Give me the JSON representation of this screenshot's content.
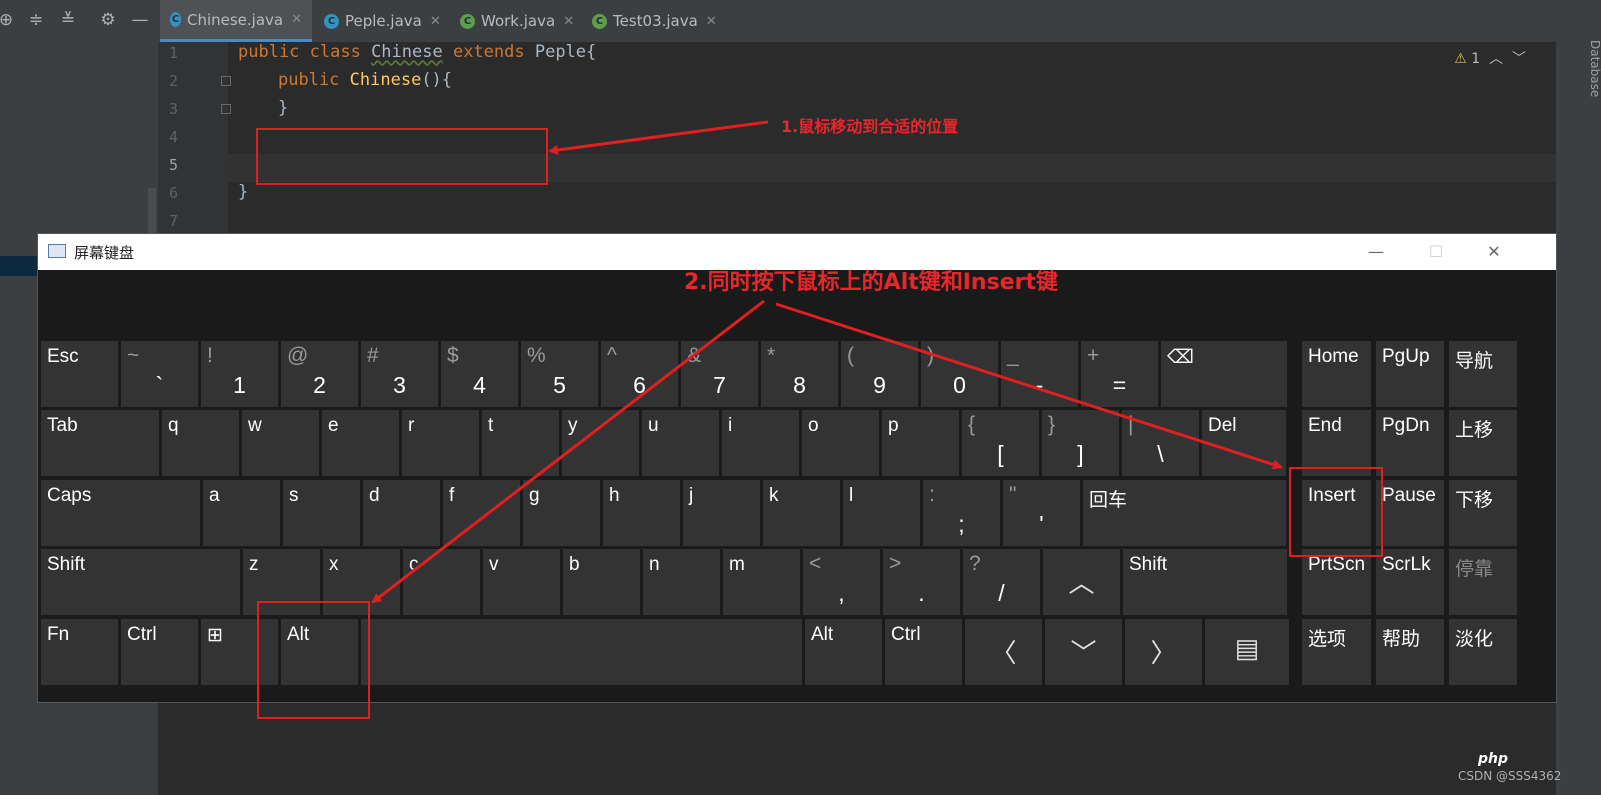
{
  "ide": {
    "tabs": [
      {
        "icon": "C",
        "label": "Chinese.java",
        "close": "✕"
      },
      {
        "icon": "C",
        "label": "Peple.java",
        "close": "✕"
      },
      {
        "icon": "C",
        "label": "Work.java",
        "close": "✕"
      },
      {
        "icon": "C",
        "label": "Test03.java",
        "close": "✕"
      }
    ],
    "toolbar_icons": [
      "target-icon",
      "expand-all-icon",
      "collapse-all-icon",
      "gear-icon",
      "minimize-icon"
    ],
    "line_numbers": [
      "1",
      "2",
      "3",
      "4",
      "5",
      "6",
      "7"
    ],
    "code": {
      "l1_kw": "public class ",
      "l1_cls": "Chinese",
      "l1_kw2": " extends ",
      "l1_rest": "Peple{",
      "l2_kw": "public ",
      "l2_fn": "Chinese",
      "l2_rest": "(){",
      "l3": "}",
      "l6": "}"
    },
    "warning_count": "1",
    "side_label": "Database",
    "colors": {
      "keyword": "#cc7832",
      "function": "#ffc66d",
      "text": "#a9b7c6",
      "background": "#2b2b2b"
    }
  },
  "osk": {
    "title": "屏幕键盘",
    "rows": {
      "r1": [
        {
          "label": "Esc"
        },
        {
          "shift": "~",
          "main": "`"
        },
        {
          "shift": "!",
          "main": "1"
        },
        {
          "shift": "@",
          "main": "2"
        },
        {
          "shift": "#",
          "main": "3"
        },
        {
          "shift": "$",
          "main": "4"
        },
        {
          "shift": "%",
          "main": "5"
        },
        {
          "shift": "^",
          "main": "6"
        },
        {
          "shift": "&",
          "main": "7"
        },
        {
          "shift": "*",
          "main": "8"
        },
        {
          "shift": "(",
          "main": "9"
        },
        {
          "shift": ")",
          "main": "0"
        },
        {
          "shift": "_",
          "main": "-"
        },
        {
          "shift": "+",
          "main": "="
        },
        {
          "label": "⌫"
        }
      ],
      "r2": [
        {
          "label": "Tab"
        },
        {
          "label": "q"
        },
        {
          "label": "w"
        },
        {
          "label": "e"
        },
        {
          "label": "r"
        },
        {
          "label": "t"
        },
        {
          "label": "y"
        },
        {
          "label": "u"
        },
        {
          "label": "i"
        },
        {
          "label": "o"
        },
        {
          "label": "p"
        },
        {
          "shift": "{",
          "main": "["
        },
        {
          "shift": "}",
          "main": "]"
        },
        {
          "shift": "|",
          "main": "\\"
        },
        {
          "label": "Del"
        }
      ],
      "r3": [
        {
          "label": "Caps"
        },
        {
          "label": "a"
        },
        {
          "label": "s"
        },
        {
          "label": "d"
        },
        {
          "label": "f"
        },
        {
          "label": "g"
        },
        {
          "label": "h"
        },
        {
          "label": "j"
        },
        {
          "label": "k"
        },
        {
          "label": "l"
        },
        {
          "shift": ":",
          "main": ";"
        },
        {
          "shift": "\"",
          "main": "'"
        },
        {
          "label": "回车"
        }
      ],
      "r4": [
        {
          "label": "Shift"
        },
        {
          "label": "z"
        },
        {
          "label": "x"
        },
        {
          "label": "c"
        },
        {
          "label": "v"
        },
        {
          "label": "b"
        },
        {
          "label": "n"
        },
        {
          "label": "m"
        },
        {
          "shift": "<",
          "main": ","
        },
        {
          "shift": ">",
          "main": "."
        },
        {
          "shift": "?",
          "main": "/"
        },
        {
          "nav": "︿"
        },
        {
          "label": "Shift"
        }
      ],
      "r5": [
        {
          "label": "Fn"
        },
        {
          "label": "Ctrl"
        },
        {
          "label": "⊞"
        },
        {
          "label": "Alt"
        },
        {
          "label": ""
        },
        {
          "label": "Alt"
        },
        {
          "label": "Ctrl"
        },
        {
          "nav": "〈"
        },
        {
          "nav": "﹀"
        },
        {
          "nav": "〉"
        },
        {
          "nav": "▤"
        }
      ]
    },
    "side_keys": [
      [
        "Home",
        "PgUp",
        "导航"
      ],
      [
        "End",
        "PgDn",
        "上移"
      ],
      [
        "Insert",
        "Pause",
        "下移"
      ],
      [
        "PrtScn",
        "ScrLk",
        "停靠"
      ],
      [
        "选项",
        "帮助",
        "淡化"
      ]
    ]
  },
  "annotations": {
    "step1": "1.鼠标移动到合适的位置",
    "step2": "2.同时按下鼠标上的Alt键和Insert键",
    "color": "#e8262b"
  },
  "watermark": "CSDN @SSS4362",
  "php_logo": "php"
}
